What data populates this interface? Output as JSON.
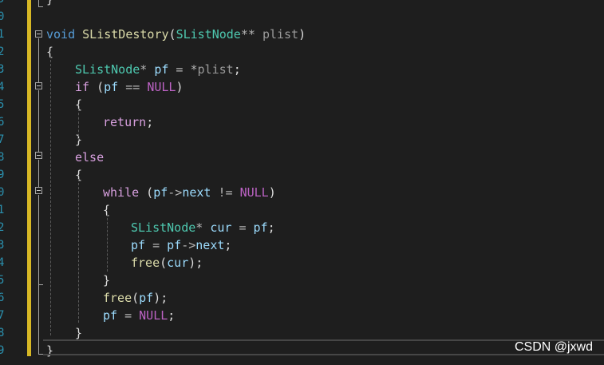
{
  "editor": {
    "lines": [
      {
        "num": "9",
        "tokens": [
          {
            "t": "}",
            "c": "punc"
          }
        ]
      },
      {
        "num": "0",
        "tokens": []
      },
      {
        "num": "1",
        "tokens": [
          {
            "t": "void",
            "c": "kw"
          },
          {
            "t": " "
          },
          {
            "t": "SListDestory",
            "c": "fn"
          },
          {
            "t": "(",
            "c": "punc"
          },
          {
            "t": "SListNode",
            "c": "type"
          },
          {
            "t": "**",
            "c": "op"
          },
          {
            "t": " "
          },
          {
            "t": "plist",
            "c": "param"
          },
          {
            "t": ")",
            "c": "punc"
          }
        ]
      },
      {
        "num": "2",
        "tokens": [
          {
            "t": "{",
            "c": "punc"
          }
        ]
      },
      {
        "num": "3",
        "tokens": [
          {
            "t": "SListNode",
            "c": "type"
          },
          {
            "t": "*",
            "c": "op"
          },
          {
            "t": " "
          },
          {
            "t": "pf",
            "c": "var"
          },
          {
            "t": " = ",
            "c": "op"
          },
          {
            "t": "*",
            "c": "op"
          },
          {
            "t": "plist",
            "c": "param"
          },
          {
            "t": ";",
            "c": "punc"
          }
        ]
      },
      {
        "num": "4",
        "tokens": [
          {
            "t": "if",
            "c": "kw2"
          },
          {
            "t": " ("
          },
          {
            "t": "pf",
            "c": "var"
          },
          {
            "t": " == ",
            "c": "op"
          },
          {
            "t": "NULL",
            "c": "mac"
          },
          {
            "t": ")",
            "c": "punc"
          }
        ]
      },
      {
        "num": "5",
        "tokens": [
          {
            "t": "{",
            "c": "punc"
          }
        ]
      },
      {
        "num": "6",
        "tokens": [
          {
            "t": "return",
            "c": "kw2"
          },
          {
            "t": ";",
            "c": "punc"
          }
        ]
      },
      {
        "num": "7",
        "tokens": [
          {
            "t": "}",
            "c": "punc"
          }
        ]
      },
      {
        "num": "8",
        "tokens": [
          {
            "t": "else",
            "c": "kw2"
          }
        ]
      },
      {
        "num": "9",
        "tokens": [
          {
            "t": "{",
            "c": "punc"
          }
        ]
      },
      {
        "num": "0",
        "tokens": [
          {
            "t": "while",
            "c": "kw2"
          },
          {
            "t": " ("
          },
          {
            "t": "pf",
            "c": "var"
          },
          {
            "t": "->",
            "c": "op"
          },
          {
            "t": "next",
            "c": "var"
          },
          {
            "t": " != ",
            "c": "op"
          },
          {
            "t": "NULL",
            "c": "mac"
          },
          {
            "t": ")",
            "c": "punc"
          }
        ]
      },
      {
        "num": "1",
        "tokens": [
          {
            "t": "{",
            "c": "punc"
          }
        ]
      },
      {
        "num": "2",
        "tokens": [
          {
            "t": "SListNode",
            "c": "type"
          },
          {
            "t": "*",
            "c": "op"
          },
          {
            "t": " "
          },
          {
            "t": "cur",
            "c": "var"
          },
          {
            "t": " = ",
            "c": "op"
          },
          {
            "t": "pf",
            "c": "var"
          },
          {
            "t": ";",
            "c": "punc"
          }
        ]
      },
      {
        "num": "3",
        "tokens": [
          {
            "t": "pf",
            "c": "var"
          },
          {
            "t": " = ",
            "c": "op"
          },
          {
            "t": "pf",
            "c": "var"
          },
          {
            "t": "->",
            "c": "op"
          },
          {
            "t": "next",
            "c": "var"
          },
          {
            "t": ";",
            "c": "punc"
          }
        ]
      },
      {
        "num": "4",
        "tokens": [
          {
            "t": "free",
            "c": "fn"
          },
          {
            "t": "(",
            "c": "punc"
          },
          {
            "t": "cur",
            "c": "var"
          },
          {
            "t": ");",
            "c": "punc"
          }
        ]
      },
      {
        "num": "5",
        "tokens": [
          {
            "t": "}",
            "c": "punc"
          }
        ]
      },
      {
        "num": "6",
        "tokens": [
          {
            "t": "free",
            "c": "fn"
          },
          {
            "t": "(",
            "c": "punc"
          },
          {
            "t": "pf",
            "c": "var"
          },
          {
            "t": ");",
            "c": "punc"
          }
        ]
      },
      {
        "num": "7",
        "tokens": [
          {
            "t": "pf",
            "c": "var"
          },
          {
            "t": " = ",
            "c": "op"
          },
          {
            "t": "NULL",
            "c": "mac"
          },
          {
            "t": ";",
            "c": "punc"
          }
        ]
      },
      {
        "num": "8",
        "tokens": [
          {
            "t": "}",
            "c": "punc"
          }
        ]
      },
      {
        "num": "9",
        "tokens": [
          {
            "t": "}",
            "c": "punc"
          }
        ]
      }
    ]
  },
  "watermark": "CSDN @jxwd",
  "colors": {
    "background": "#1e1e1e",
    "line_number": "#2b91af",
    "change_bar": "#d7b825",
    "keyword": "#569cd6",
    "control_keyword": "#d8a0df",
    "type": "#4ec9b0",
    "function": "#dcdcaa",
    "variable": "#9cdcfe",
    "macro": "#bd63c5"
  }
}
